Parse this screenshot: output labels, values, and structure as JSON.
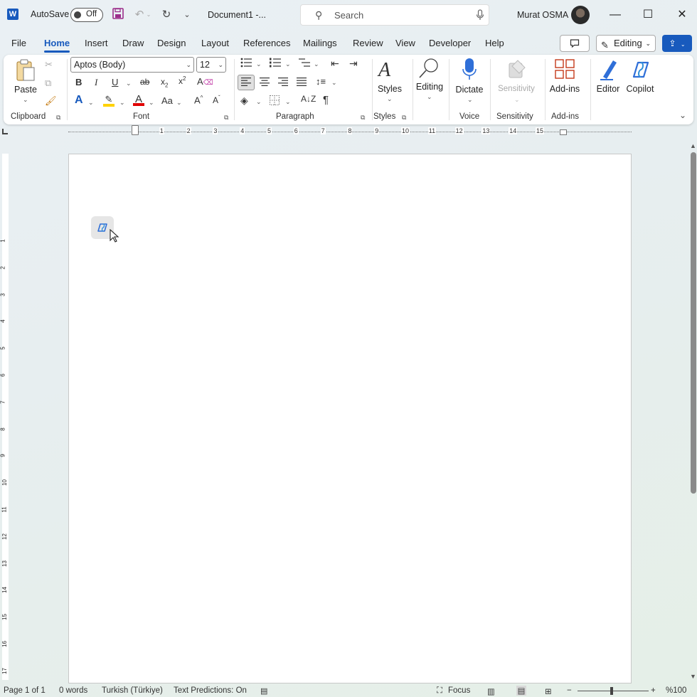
{
  "titlebar": {
    "autosave_label": "AutoSave",
    "autosave_state": "Off",
    "doc_title": "Document1  -...",
    "search_placeholder": "Search",
    "user_name": "Murat OSMA"
  },
  "tabs": [
    "File",
    "Home",
    "Insert",
    "Draw",
    "Design",
    "Layout",
    "References",
    "Mailings",
    "Review",
    "View",
    "Developer",
    "Help"
  ],
  "active_tab": "Home",
  "mode_button": "Editing",
  "ribbon": {
    "clipboard": {
      "paste": "Paste",
      "label": "Clipboard"
    },
    "font": {
      "family": "Aptos (Body)",
      "size": "12",
      "label": "Font"
    },
    "paragraph": {
      "label": "Paragraph"
    },
    "styles": {
      "button": "Styles",
      "label": "Styles"
    },
    "editing": {
      "button": "Editing"
    },
    "voice": {
      "button": "Dictate",
      "label": "Voice"
    },
    "sensitivity": {
      "button": "Sensitivity",
      "label": "Sensitivity"
    },
    "addins": {
      "button": "Add-ins",
      "label": "Add-ins"
    },
    "editor": {
      "button": "Editor"
    },
    "copilot": {
      "button": "Copilot"
    }
  },
  "ruler_numbers": [
    "1",
    "2",
    "3",
    "4",
    "5",
    "6",
    "7",
    "8",
    "9",
    "10",
    "11",
    "12",
    "13",
    "14",
    "15"
  ],
  "vruler_numbers": [
    "1",
    "2",
    "3",
    "4",
    "5",
    "6",
    "7",
    "8",
    "9",
    "10",
    "11",
    "12",
    "13",
    "14",
    "15",
    "16",
    "17"
  ],
  "status": {
    "page": "Page 1 of 1",
    "words": "0 words",
    "language": "Turkish (Türkiye)",
    "predictions": "Text Predictions: On",
    "focus": "Focus",
    "zoom": "%100"
  },
  "colors": {
    "accent": "#185abd",
    "highlight": "#ffd200",
    "font_color": "#e00000"
  }
}
